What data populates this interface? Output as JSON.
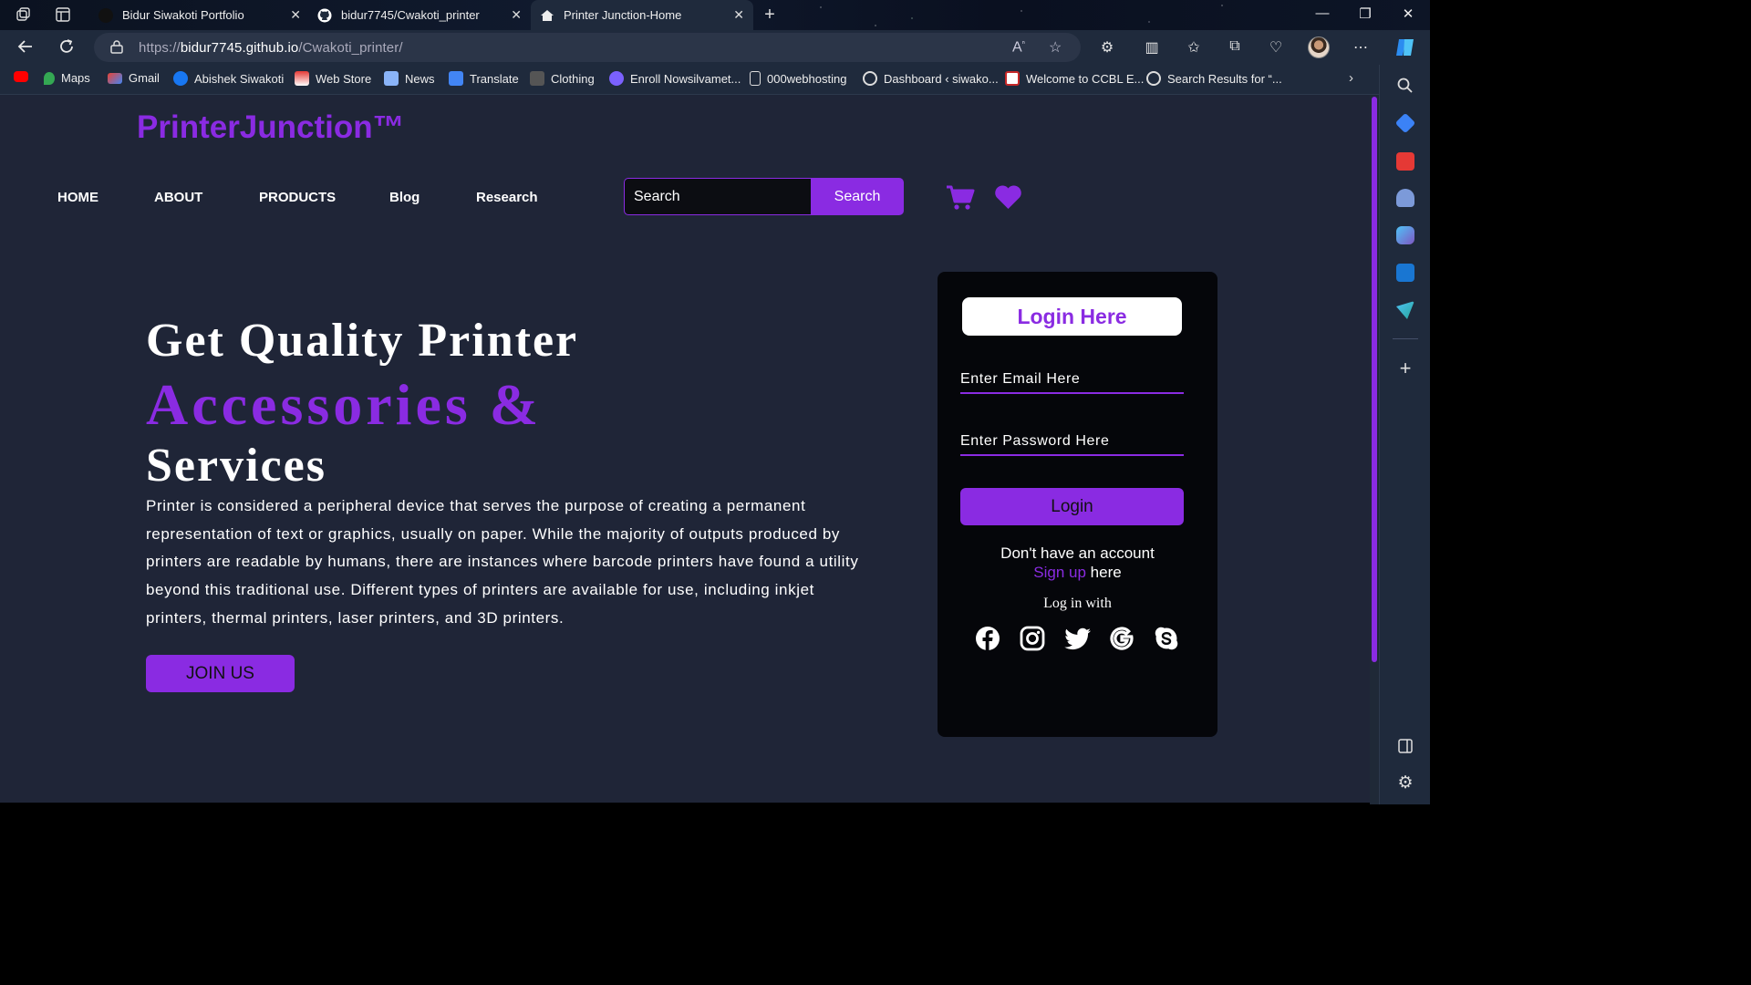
{
  "browser": {
    "tabs": [
      {
        "title": "Bidur Siwakoti Portfolio",
        "active": false
      },
      {
        "title": "bidur7745/Cwakoti_printer",
        "active": false
      },
      {
        "title": "Printer Junction-Home",
        "active": true
      }
    ],
    "address": {
      "scheme": "https://",
      "host": "bidur7745.github.io",
      "path": "/Cwakoti_printer/"
    },
    "bookmarks": [
      "Maps",
      "Gmail",
      "Abishek Siwakoti",
      "Web Store",
      "News",
      "Translate",
      "Clothing",
      "Enroll Nowsilvamet...",
      "000webhosting",
      "Dashboard ‹ siwako...",
      "Welcome to CCBL E...",
      "Search Results for “..."
    ],
    "accent_color": "#8a2be2"
  },
  "page": {
    "logo": "PrinterJunction™",
    "nav": [
      "HOME",
      "ABOUT",
      "PRODUCTS",
      "Blog",
      "Research"
    ],
    "search": {
      "placeholder": "Search",
      "button": "Search"
    },
    "hero": {
      "line1": "Get Quality Printer",
      "line2": "Accessories &",
      "line3": "Services",
      "description": "Printer is considered a peripheral device that serves the purpose of creating a permanent representation of text or graphics, usually on paper. While the majority of outputs produced by printers are readable by humans, there are instances where barcode printers have found a utility beyond this traditional use. Different types of printers are available for use, including inkjet printers, thermal printers, laser printers, and 3D printers.",
      "cta": "JOIN US"
    },
    "login": {
      "title": "Login Here",
      "email_placeholder": "Enter Email Here",
      "password_placeholder": "Enter Password Here",
      "button": "Login",
      "no_account": "Don't have an account",
      "signup_link": "Sign up",
      "signup_suffix": " here",
      "login_with": "Log in with",
      "social_icons": [
        "facebook-icon",
        "instagram-icon",
        "twitter-icon",
        "google-icon",
        "skype-icon"
      ]
    }
  }
}
